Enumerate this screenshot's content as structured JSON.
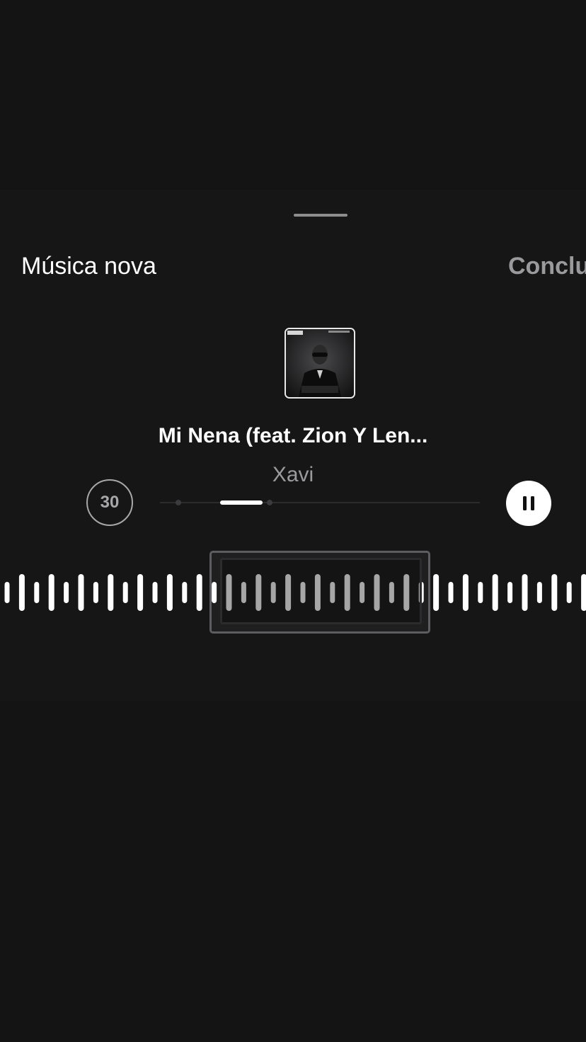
{
  "sheet": {
    "title": "Música nova",
    "done_label": "Conclu"
  },
  "song": {
    "title": "Mi Nena (feat. Zion Y Len...",
    "artist": "Xavi",
    "cover_icon": "album-cover-image"
  },
  "player": {
    "clip_duration": "30",
    "progress_fraction": 0.28,
    "pause_icon": "pause-icon"
  },
  "waveform": {
    "bar_count": 40
  },
  "colors": {
    "background": "#141415",
    "sheet": "#161617",
    "text_primary": "#ffffff",
    "text_secondary": "#9b9b9d",
    "accent": "#ffffff"
  }
}
